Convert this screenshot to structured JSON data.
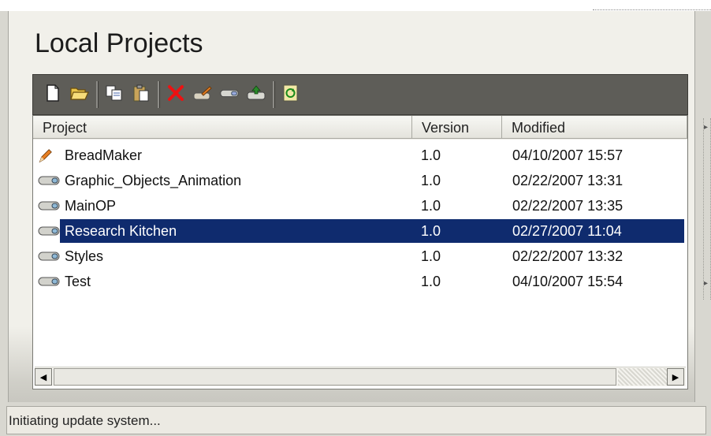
{
  "page_title": "Local Projects",
  "toolbar": {
    "buttons": [
      {
        "name": "new-project-icon"
      },
      {
        "name": "open-folder-icon"
      },
      {
        "name": "copy-icon"
      },
      {
        "name": "paste-icon"
      },
      {
        "name": "delete-icon"
      },
      {
        "name": "edit-project-icon"
      },
      {
        "name": "project-properties-icon"
      },
      {
        "name": "export-project-icon"
      },
      {
        "name": "update-icon"
      }
    ]
  },
  "list": {
    "columns": [
      "Project",
      "Version",
      "Modified"
    ],
    "rows": [
      {
        "project": "BreadMaker",
        "version": "1.0",
        "modified": "04/10/2007 15:57",
        "icon": "pencil-icon",
        "selected": false
      },
      {
        "project": "Graphic_Objects_Animation",
        "version": "1.0",
        "modified": "02/22/2007 13:31",
        "icon": "project-icon",
        "selected": false
      },
      {
        "project": "MainOP",
        "version": "1.0",
        "modified": "02/22/2007 13:35",
        "icon": "project-icon",
        "selected": false
      },
      {
        "project": "Research Kitchen",
        "version": "1.0",
        "modified": "02/27/2007 11:04",
        "icon": "project-icon",
        "selected": true
      },
      {
        "project": "Styles",
        "version": "1.0",
        "modified": "02/22/2007 13:32",
        "icon": "project-icon",
        "selected": false
      },
      {
        "project": "Test",
        "version": "1.0",
        "modified": "04/10/2007 15:54",
        "icon": "project-icon",
        "selected": false
      }
    ]
  },
  "status_text": "Initiating update system...",
  "colors": {
    "selection": "#0f2b6e",
    "toolbar": "#5e5d58",
    "background": "#d8d7d0"
  }
}
